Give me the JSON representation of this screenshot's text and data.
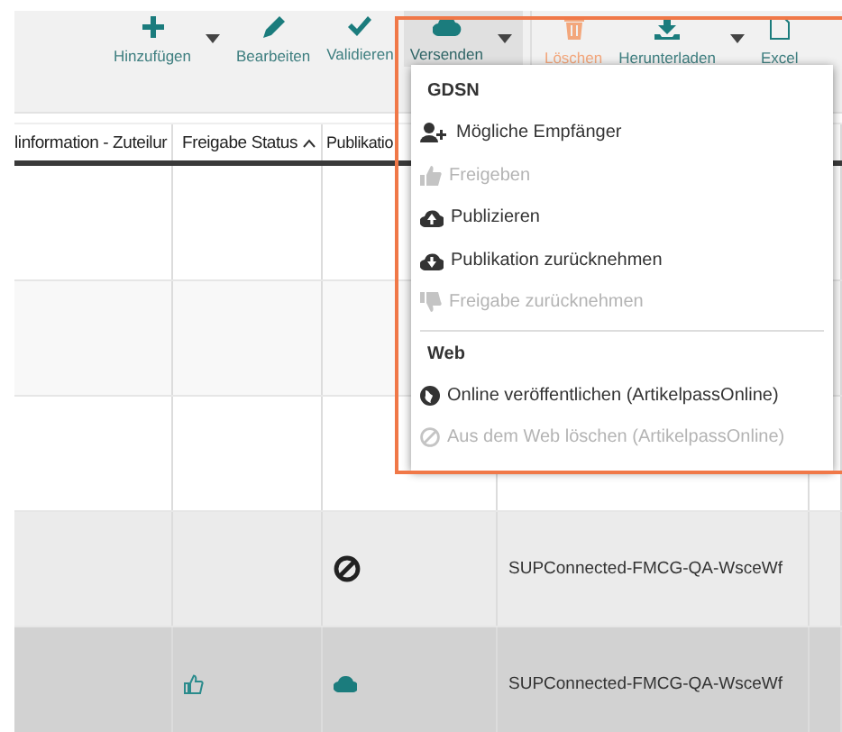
{
  "toolbar": {
    "buttons": [
      {
        "label": "Hinzufügen",
        "kind": "add",
        "disabled": false,
        "selected": false,
        "has_menu": true
      },
      {
        "label": "Bearbeiten",
        "kind": "edit",
        "disabled": false,
        "selected": false,
        "has_menu": false
      },
      {
        "label": "Validieren",
        "kind": "validate",
        "disabled": false,
        "selected": false,
        "has_menu": false
      },
      {
        "label": "Versenden",
        "kind": "send",
        "disabled": false,
        "selected": true,
        "has_menu": true
      },
      {
        "label": "Löschen",
        "kind": "delete",
        "disabled": true,
        "selected": false,
        "has_menu": false
      },
      {
        "label": "Herunterladen",
        "kind": "download",
        "disabled": false,
        "selected": false,
        "has_menu": true
      },
      {
        "label": "Excel",
        "kind": "excel",
        "disabled": false,
        "selected": false,
        "has_menu": false
      }
    ]
  },
  "table": {
    "columns": [
      {
        "label": "linformation - Zuteilur"
      },
      {
        "label": "Freigabe Status",
        "sorted": true
      },
      {
        "label": "Publikatio"
      }
    ],
    "rows": [
      {
        "selected": false
      },
      {
        "selected": false
      },
      {
        "selected": false
      },
      {
        "selected": false,
        "hovered": true,
        "publication": {
          "kind": "blocked"
        },
        "recipient": "SUPConnected-FMCG-QA-WsceWf"
      },
      {
        "selected": true,
        "status": {
          "kind": "approved"
        },
        "publication": {
          "kind": "published"
        },
        "recipient": "SUPConnected-FMCG-QA-WsceWf"
      }
    ]
  },
  "dropdown": {
    "sections": [
      {
        "title": "GDSN",
        "items": [
          {
            "label": "Mögliche Empfänger",
            "kind": "recipients",
            "disabled": false
          },
          {
            "label": "Freigeben",
            "kind": "approve",
            "disabled": true
          },
          {
            "label": "Publizieren",
            "kind": "publish",
            "disabled": false
          },
          {
            "label": "Publikation zurücknehmen",
            "kind": "unpublish",
            "disabled": false
          },
          {
            "label": "Freigabe zurücknehmen",
            "kind": "revoke",
            "disabled": true
          }
        ]
      },
      {
        "title": "Web",
        "items": [
          {
            "label": "Online veröffentlichen (ArtikelpassOnline)",
            "kind": "online",
            "disabled": false
          },
          {
            "label": "Aus dem Web löschen (ArtikelpassOnline)",
            "kind": "remove",
            "disabled": true
          }
        ]
      }
    ]
  }
}
